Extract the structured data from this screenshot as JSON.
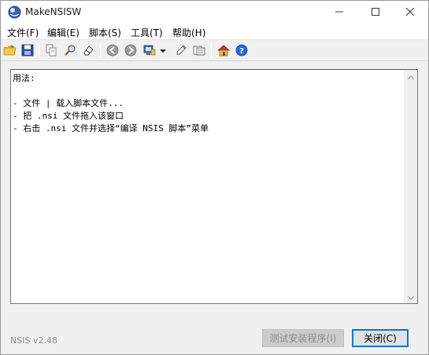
{
  "window": {
    "title": "MakeNSISW"
  },
  "menu": [
    {
      "label": "文件(F)"
    },
    {
      "label": "编辑(E)"
    },
    {
      "label": "脚本(S)"
    },
    {
      "label": "工具(T)"
    },
    {
      "label": "帮助(H)"
    }
  ],
  "toolbar": {
    "icons": [
      "load-script-icon",
      "save-icon",
      "copy-icon",
      "find-icon",
      "clear-icon",
      "back-icon",
      "forward-icon",
      "test-installer-icon",
      "dropdown-arrow-icon",
      "edit-script-icon",
      "browse-icon",
      "nsis-home-icon",
      "help-icon"
    ]
  },
  "output": {
    "text": "用法:\n\n- 文件 | 载入脚本文件...\n- 把 .nsi 文件拖入该窗口\n- 右击 .nsi 文件并选择“编译 NSIS 脚本”菜单"
  },
  "footer": {
    "version": "NSIS v2.48",
    "test_button": "测试安装程序(I)",
    "close_button": "关闭(C)"
  },
  "colors": {
    "accent": "#0078d7",
    "window_bg": "#f0f0f0",
    "output_bg": "#ffffff"
  }
}
